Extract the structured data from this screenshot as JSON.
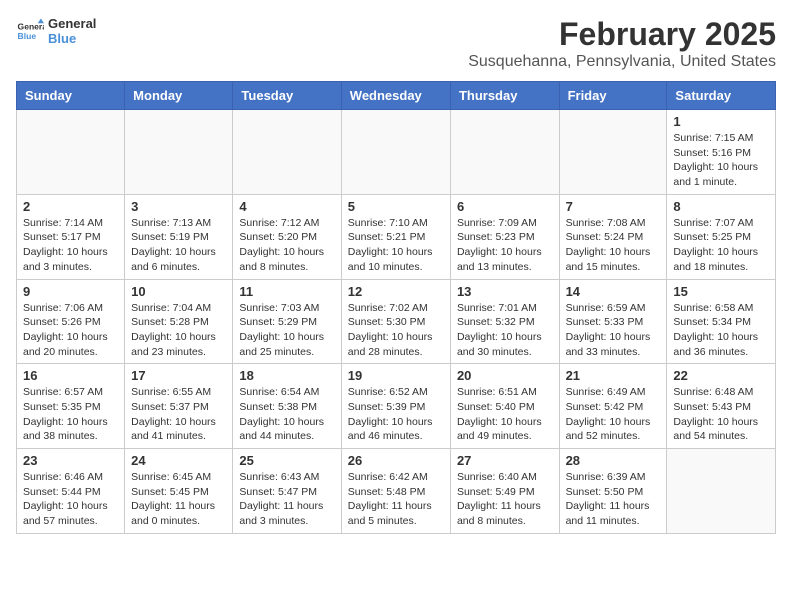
{
  "header": {
    "logo_general": "General",
    "logo_blue": "Blue",
    "title": "February 2025",
    "location": "Susquehanna, Pennsylvania, United States"
  },
  "weekdays": [
    "Sunday",
    "Monday",
    "Tuesday",
    "Wednesday",
    "Thursday",
    "Friday",
    "Saturday"
  ],
  "weeks": [
    [
      {
        "day": null
      },
      {
        "day": null
      },
      {
        "day": null
      },
      {
        "day": null
      },
      {
        "day": null
      },
      {
        "day": null
      },
      {
        "day": 1,
        "sunrise": "7:15 AM",
        "sunset": "5:16 PM",
        "daylight": "10 hours and 1 minute."
      }
    ],
    [
      {
        "day": 2,
        "sunrise": "7:14 AM",
        "sunset": "5:17 PM",
        "daylight": "10 hours and 3 minutes."
      },
      {
        "day": 3,
        "sunrise": "7:13 AM",
        "sunset": "5:19 PM",
        "daylight": "10 hours and 6 minutes."
      },
      {
        "day": 4,
        "sunrise": "7:12 AM",
        "sunset": "5:20 PM",
        "daylight": "10 hours and 8 minutes."
      },
      {
        "day": 5,
        "sunrise": "7:10 AM",
        "sunset": "5:21 PM",
        "daylight": "10 hours and 10 minutes."
      },
      {
        "day": 6,
        "sunrise": "7:09 AM",
        "sunset": "5:23 PM",
        "daylight": "10 hours and 13 minutes."
      },
      {
        "day": 7,
        "sunrise": "7:08 AM",
        "sunset": "5:24 PM",
        "daylight": "10 hours and 15 minutes."
      },
      {
        "day": 8,
        "sunrise": "7:07 AM",
        "sunset": "5:25 PM",
        "daylight": "10 hours and 18 minutes."
      }
    ],
    [
      {
        "day": 9,
        "sunrise": "7:06 AM",
        "sunset": "5:26 PM",
        "daylight": "10 hours and 20 minutes."
      },
      {
        "day": 10,
        "sunrise": "7:04 AM",
        "sunset": "5:28 PM",
        "daylight": "10 hours and 23 minutes."
      },
      {
        "day": 11,
        "sunrise": "7:03 AM",
        "sunset": "5:29 PM",
        "daylight": "10 hours and 25 minutes."
      },
      {
        "day": 12,
        "sunrise": "7:02 AM",
        "sunset": "5:30 PM",
        "daylight": "10 hours and 28 minutes."
      },
      {
        "day": 13,
        "sunrise": "7:01 AM",
        "sunset": "5:32 PM",
        "daylight": "10 hours and 30 minutes."
      },
      {
        "day": 14,
        "sunrise": "6:59 AM",
        "sunset": "5:33 PM",
        "daylight": "10 hours and 33 minutes."
      },
      {
        "day": 15,
        "sunrise": "6:58 AM",
        "sunset": "5:34 PM",
        "daylight": "10 hours and 36 minutes."
      }
    ],
    [
      {
        "day": 16,
        "sunrise": "6:57 AM",
        "sunset": "5:35 PM",
        "daylight": "10 hours and 38 minutes."
      },
      {
        "day": 17,
        "sunrise": "6:55 AM",
        "sunset": "5:37 PM",
        "daylight": "10 hours and 41 minutes."
      },
      {
        "day": 18,
        "sunrise": "6:54 AM",
        "sunset": "5:38 PM",
        "daylight": "10 hours and 44 minutes."
      },
      {
        "day": 19,
        "sunrise": "6:52 AM",
        "sunset": "5:39 PM",
        "daylight": "10 hours and 46 minutes."
      },
      {
        "day": 20,
        "sunrise": "6:51 AM",
        "sunset": "5:40 PM",
        "daylight": "10 hours and 49 minutes."
      },
      {
        "day": 21,
        "sunrise": "6:49 AM",
        "sunset": "5:42 PM",
        "daylight": "10 hours and 52 minutes."
      },
      {
        "day": 22,
        "sunrise": "6:48 AM",
        "sunset": "5:43 PM",
        "daylight": "10 hours and 54 minutes."
      }
    ],
    [
      {
        "day": 23,
        "sunrise": "6:46 AM",
        "sunset": "5:44 PM",
        "daylight": "10 hours and 57 minutes."
      },
      {
        "day": 24,
        "sunrise": "6:45 AM",
        "sunset": "5:45 PM",
        "daylight": "11 hours and 0 minutes."
      },
      {
        "day": 25,
        "sunrise": "6:43 AM",
        "sunset": "5:47 PM",
        "daylight": "11 hours and 3 minutes."
      },
      {
        "day": 26,
        "sunrise": "6:42 AM",
        "sunset": "5:48 PM",
        "daylight": "11 hours and 5 minutes."
      },
      {
        "day": 27,
        "sunrise": "6:40 AM",
        "sunset": "5:49 PM",
        "daylight": "11 hours and 8 minutes."
      },
      {
        "day": 28,
        "sunrise": "6:39 AM",
        "sunset": "5:50 PM",
        "daylight": "11 hours and 11 minutes."
      },
      {
        "day": null
      }
    ]
  ]
}
